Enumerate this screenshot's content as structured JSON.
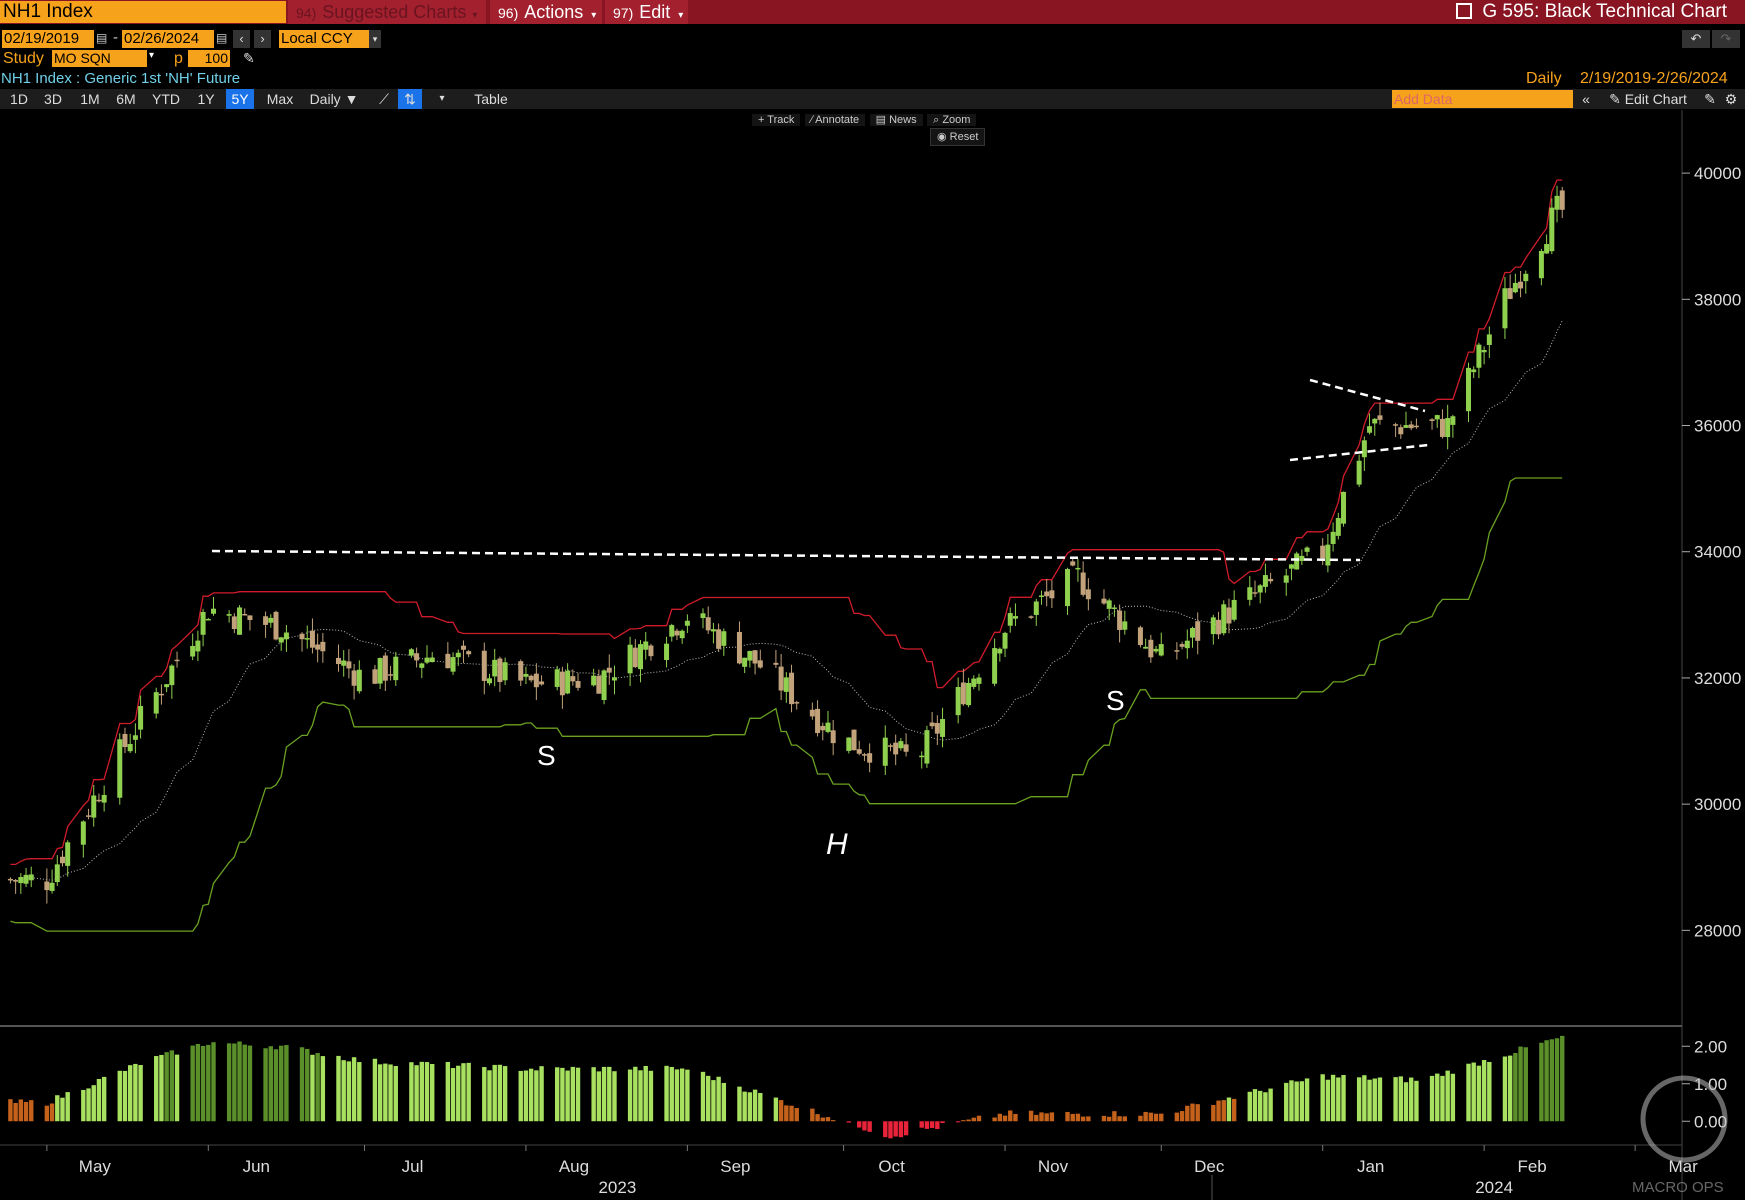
{
  "header": {
    "ticker": "NH1 Index",
    "suggested": {
      "num": "94)",
      "label": "Suggested Charts"
    },
    "actions": {
      "num": "96)",
      "label": "Actions"
    },
    "edit": {
      "num": "97)",
      "label": "Edit"
    },
    "title": "G 595: Black Technical Chart"
  },
  "controls": {
    "start_date": "02/19/2019",
    "end_date": "02/26/2024",
    "date_sep": "-",
    "currency": "Local CCY",
    "study_label": "Study",
    "study_value": "MO SQN",
    "p_label": "p",
    "p_value": "100",
    "security_desc": "NH1 Index : Generic 1st 'NH' Future",
    "freq_label": "Daily",
    "range_label": "2/19/2019-2/26/2024"
  },
  "tabs": [
    "1D",
    "3D",
    "1M",
    "6M",
    "YTD",
    "1Y",
    "5Y",
    "Max"
  ],
  "period_select": "Daily",
  "table_label": "Table",
  "add_data_placeholder": "Add Data",
  "edit_chart_label": "Edit Chart",
  "chart_tools": [
    "Track",
    "Annotate",
    "News",
    "Zoom"
  ],
  "reset_label": "Reset",
  "annotations": {
    "s1": "S",
    "h": "H",
    "s2": "S"
  },
  "watermark": "MACRO OPS",
  "colors": {
    "accent": "#f7a21b",
    "topbar": "#8a1522",
    "up": "#8fd14f",
    "down": "#c2a27a",
    "upper_band": "#d01c2a",
    "lower_band": "#6aa121"
  },
  "chart_data": [
    {
      "type": "candlestick",
      "title": "NH1 Index",
      "ylim": [
        26500,
        41000
      ],
      "y_ticks": [
        28000,
        30000,
        32000,
        34000,
        36000,
        38000,
        40000
      ],
      "x_month_labels": [
        "May",
        "Jun",
        "Jul",
        "Aug",
        "Sep",
        "Oct",
        "Nov",
        "Dec",
        "Jan",
        "Feb",
        "Mar"
      ],
      "x_year_labels": [
        "2023",
        "2024"
      ],
      "close_approx": [
        {
          "x": "2023-05-01",
          "y": 28800
        },
        {
          "x": "2023-05-15",
          "y": 30800
        },
        {
          "x": "2023-06-01",
          "y": 33100
        },
        {
          "x": "2023-06-15",
          "y": 32800
        },
        {
          "x": "2023-07-01",
          "y": 32000
        },
        {
          "x": "2023-07-15",
          "y": 32400
        },
        {
          "x": "2023-08-01",
          "y": 31900
        },
        {
          "x": "2023-08-15",
          "y": 32000
        },
        {
          "x": "2023-09-01",
          "y": 33000
        },
        {
          "x": "2023-09-15",
          "y": 32200
        },
        {
          "x": "2023-10-01",
          "y": 31000
        },
        {
          "x": "2023-10-15",
          "y": 30700
        },
        {
          "x": "2023-11-01",
          "y": 32800
        },
        {
          "x": "2023-11-15",
          "y": 33600
        },
        {
          "x": "2023-12-01",
          "y": 32300
        },
        {
          "x": "2023-12-15",
          "y": 33100
        },
        {
          "x": "2024-01-01",
          "y": 34000
        },
        {
          "x": "2024-01-10",
          "y": 36000
        },
        {
          "x": "2024-01-25",
          "y": 36000
        },
        {
          "x": "2024-02-05",
          "y": 38000
        },
        {
          "x": "2024-02-15",
          "y": 39400
        }
      ]
    },
    {
      "type": "bar",
      "title": "MO SQN",
      "ylim": [
        -0.5,
        2.3
      ],
      "y_ticks": [
        "2.00",
        "1.00",
        "0.00"
      ],
      "values_approx": [
        {
          "x": "2023-05-01",
          "y": 0.5
        },
        {
          "x": "2023-05-20",
          "y": 1.6
        },
        {
          "x": "2023-06-01",
          "y": 2.1
        },
        {
          "x": "2023-06-15",
          "y": 2.0
        },
        {
          "x": "2023-07-01",
          "y": 1.6
        },
        {
          "x": "2023-08-01",
          "y": 1.4
        },
        {
          "x": "2023-09-01",
          "y": 1.4
        },
        {
          "x": "2023-09-20",
          "y": 0.5
        },
        {
          "x": "2023-10-10",
          "y": -0.4
        },
        {
          "x": "2023-11-01",
          "y": 0.2
        },
        {
          "x": "2023-12-01",
          "y": 0.2
        },
        {
          "x": "2024-01-01",
          "y": 1.2
        },
        {
          "x": "2024-01-20",
          "y": 1.1
        },
        {
          "x": "2024-02-15",
          "y": 2.2
        }
      ]
    }
  ]
}
